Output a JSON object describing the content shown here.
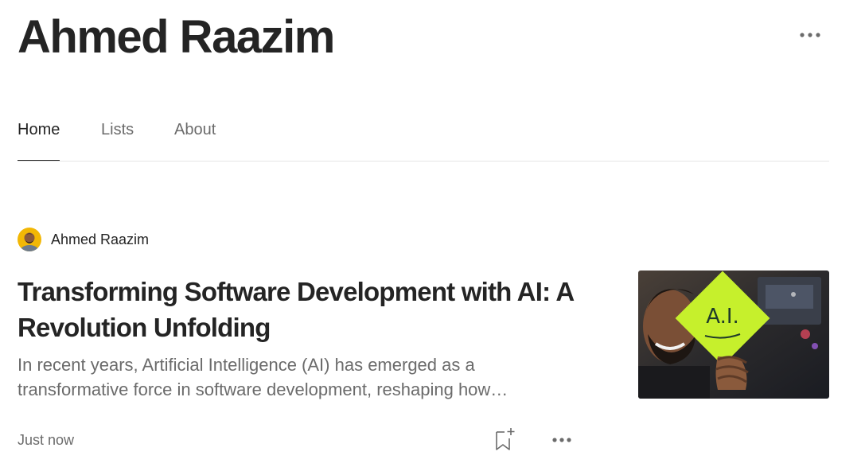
{
  "profile": {
    "name": "Ahmed Raazim"
  },
  "tabs": [
    {
      "label": "Home",
      "active": true
    },
    {
      "label": "Lists",
      "active": false
    },
    {
      "label": "About",
      "active": false
    }
  ],
  "post": {
    "author": "Ahmed Raazim",
    "title": "Transforming Software Development with AI: A Revolution Unfolding",
    "excerpt": "In recent years, Artificial Intelligence (AI) has emerged as a transformative force in software development, reshaping how…",
    "date": "Just now",
    "thumbnail_text": "A.I."
  },
  "icons": {
    "more": "more-horizontal-icon",
    "save": "bookmark-add-icon"
  },
  "colors": {
    "text_primary": "#242424",
    "text_secondary": "#6b6b6b",
    "divider": "#e6e6e6",
    "sticky_note": "#c6f02c"
  }
}
